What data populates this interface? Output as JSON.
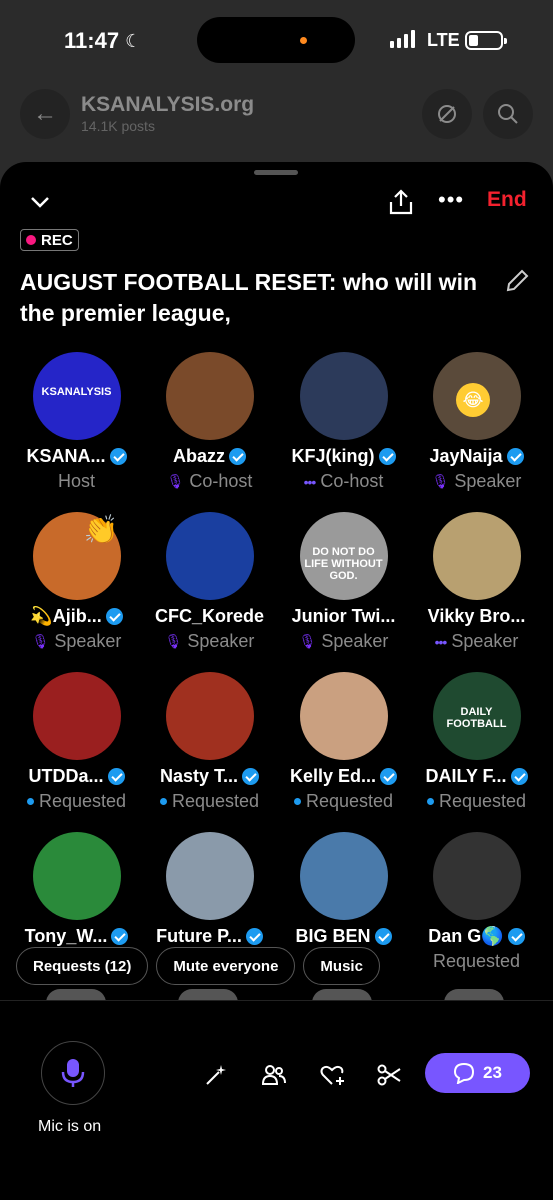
{
  "status": {
    "time": "11:47",
    "network": "LTE"
  },
  "header": {
    "title": "KSANALYSIS.org",
    "subtitle": "14.1K posts"
  },
  "space": {
    "end_label": "End",
    "rec_label": "REC",
    "title": "AUGUST FOOTBALL RESET: who will win the premier league,"
  },
  "participants": [
    {
      "name": "KSANA...",
      "role": "Host",
      "icon": "none",
      "verified": true,
      "color": "#2525c8",
      "avatar_text": "KSANALYSIS"
    },
    {
      "name": "Abazz",
      "role": "Co-host",
      "icon": "muted-mic-icon",
      "verified": true,
      "color": "#7a4a2a",
      "avatar_text": ""
    },
    {
      "name": "KFJ(king)",
      "role": "Co-host",
      "icon": "speaking-dots-icon",
      "verified": true,
      "color": "#2c3a5a",
      "avatar_text": ""
    },
    {
      "name": "JayNaija",
      "role": "Speaker",
      "icon": "muted-mic-icon",
      "verified": true,
      "color": "#5a4a3a",
      "avatar_text": ""
    },
    {
      "name": "💫Ajib...",
      "role": "Speaker",
      "icon": "muted-mic-icon",
      "verified": true,
      "color": "#c86a2a",
      "avatar_text": ""
    },
    {
      "name": "CFC_Korede",
      "role": "Speaker",
      "icon": "muted-mic-icon",
      "verified": false,
      "color": "#1a3fa0",
      "avatar_text": ""
    },
    {
      "name": "Junior Twi...",
      "role": "Speaker",
      "icon": "muted-mic-icon",
      "verified": false,
      "color": "#9a9a9a",
      "avatar_text": "DO NOT DO LIFE WITHOUT GOD."
    },
    {
      "name": "Vikky Bro...",
      "role": "Speaker",
      "icon": "speaking-dots-icon",
      "verified": false,
      "color": "#b8a070",
      "avatar_text": ""
    },
    {
      "name": "UTDDa...",
      "role": "Requested",
      "icon": "blue-dot",
      "verified": true,
      "color": "#9a1f1f",
      "avatar_text": ""
    },
    {
      "name": "Nasty T...",
      "role": "Requested",
      "icon": "blue-dot",
      "verified": true,
      "color": "#a0301f",
      "avatar_text": ""
    },
    {
      "name": "Kelly Ed...",
      "role": "Requested",
      "icon": "blue-dot",
      "verified": true,
      "color": "#caa080",
      "avatar_text": ""
    },
    {
      "name": "DAILY F...",
      "role": "Requested",
      "icon": "blue-dot",
      "verified": true,
      "color": "#1f4a30",
      "avatar_text": "DAILY FOOTBALL"
    },
    {
      "name": "Tony_W...",
      "role": "",
      "icon": "none",
      "verified": true,
      "color": "#2a8a3a",
      "avatar_text": ""
    },
    {
      "name": "Future P...",
      "role": "",
      "icon": "none",
      "verified": true,
      "color": "#8a9aaa",
      "avatar_text": ""
    },
    {
      "name": "BIG BEN",
      "role": "",
      "icon": "none",
      "verified": true,
      "color": "#4a7aaa",
      "avatar_text": ""
    },
    {
      "name": "Dan G🌎",
      "role": "Requested",
      "icon": "none",
      "verified": true,
      "color": "#333333",
      "avatar_text": ""
    }
  ],
  "pills": {
    "requests": "Requests (12)",
    "mute": "Mute everyone",
    "music": "Music"
  },
  "bottom": {
    "mic_label": "Mic is on",
    "chat_count": "23"
  },
  "colors": {
    "accent": "#7856ff",
    "verified": "#1d9bf0",
    "end": "#f4212e",
    "muted": "#f91880"
  }
}
